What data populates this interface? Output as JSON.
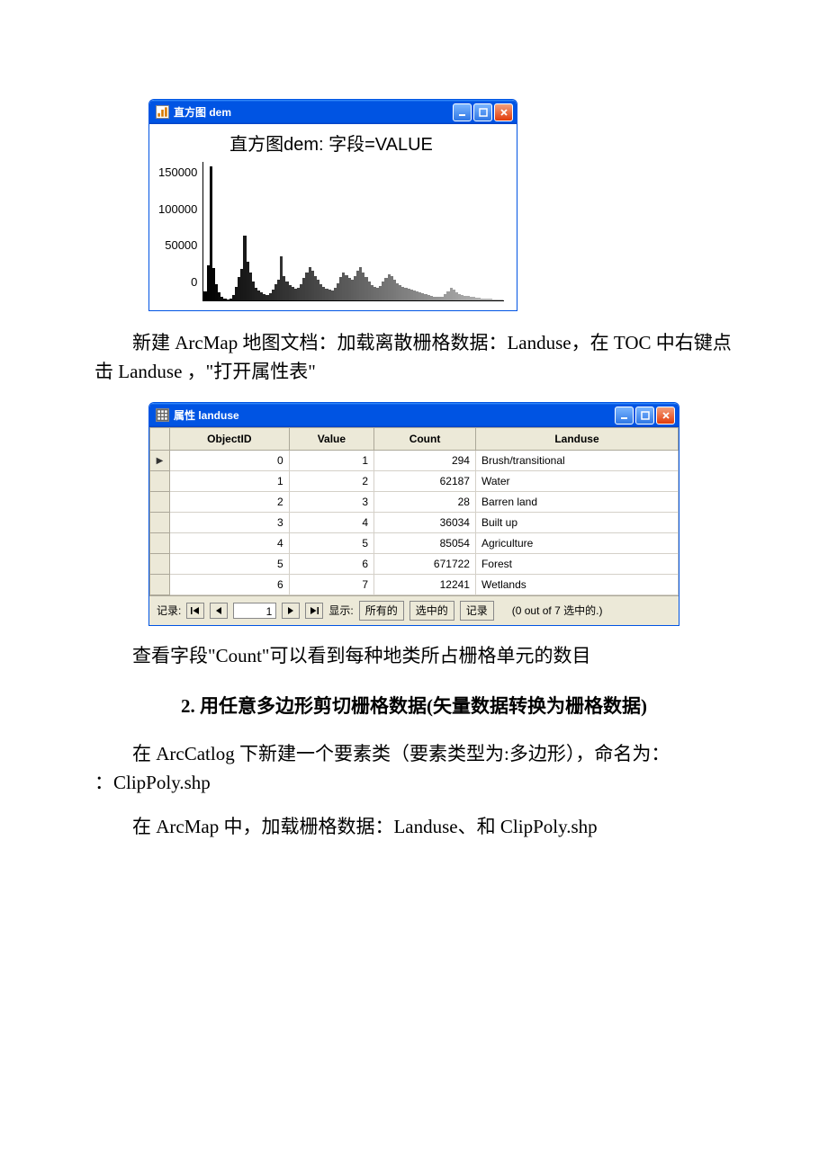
{
  "histogram": {
    "window_title": "直方图 dem",
    "chart_title": "直方图dem: 字段=VALUE",
    "y_ticks": [
      "150000",
      "100000",
      "50000",
      "0"
    ],
    "icons": {
      "minimize": "_",
      "maximize": "□",
      "close": "×"
    }
  },
  "chart_data": {
    "type": "bar",
    "title": "直方图dem: 字段=VALUE",
    "xlabel": "",
    "ylabel": "",
    "ylim": [
      0,
      150000
    ],
    "categories_note": "x represents VALUE bins (labels not shown in figure)",
    "values": [
      10000,
      38000,
      145000,
      35000,
      18000,
      9000,
      4000,
      2000,
      1000,
      2000,
      6000,
      15000,
      25000,
      34000,
      70000,
      42000,
      30000,
      20000,
      14000,
      11000,
      9000,
      7000,
      6000,
      8000,
      12000,
      18000,
      22000,
      48000,
      26000,
      20000,
      17000,
      15000,
      13000,
      14000,
      18000,
      24000,
      30000,
      36000,
      32000,
      26000,
      22000,
      18000,
      15000,
      13000,
      12000,
      11000,
      14000,
      19000,
      25000,
      30000,
      27000,
      24000,
      22000,
      26000,
      32000,
      36000,
      30000,
      25000,
      20000,
      17000,
      15000,
      14000,
      16000,
      20000,
      24000,
      28000,
      26000,
      22000,
      19000,
      17000,
      15000,
      14000,
      13000,
      12000,
      11000,
      10000,
      9000,
      8000,
      7000,
      6000,
      5000,
      4000,
      3500,
      3500,
      4000,
      7000,
      10000,
      14000,
      12000,
      9000,
      7000,
      5500,
      5000,
      4500,
      4000,
      3500,
      3000,
      2500,
      2200,
      2000,
      1800,
      1500,
      1200,
      1000,
      800,
      600
    ]
  },
  "para1_a": "新建 ",
  "para1_arcmap": "ArcMap ",
  "para1_b": "地图文档：加载离散栅格数据：",
  "para1_landuse": "Landuse",
  "para1_c": "，在 ",
  "para1_toc": "TOC ",
  "para1_d": "中右键点击 ",
  "para1_landuse2": "Landuse ",
  "para1_e": "，\"打开属性表\"",
  "attr": {
    "window_title": "属性 landuse",
    "columns": [
      "ObjectID",
      "Value",
      "Count",
      "Landuse"
    ],
    "rows": [
      {
        "ObjectID": "0",
        "Value": "1",
        "Count": "294",
        "Landuse": "Brush/transitional"
      },
      {
        "ObjectID": "1",
        "Value": "2",
        "Count": "62187",
        "Landuse": "Water"
      },
      {
        "ObjectID": "2",
        "Value": "3",
        "Count": "28",
        "Landuse": "Barren land"
      },
      {
        "ObjectID": "3",
        "Value": "4",
        "Count": "36034",
        "Landuse": "Built up"
      },
      {
        "ObjectID": "4",
        "Value": "5",
        "Count": "85054",
        "Landuse": "Agriculture"
      },
      {
        "ObjectID": "5",
        "Value": "6",
        "Count": "671722",
        "Landuse": "Forest"
      },
      {
        "ObjectID": "6",
        "Value": "7",
        "Count": "12241",
        "Landuse": "Wetlands"
      }
    ],
    "nav": {
      "label_record": "记录:",
      "current": "1",
      "label_show": "显示:",
      "btn_all": "所有的",
      "btn_selected": "选中的",
      "btn_record": "记录",
      "status": "(0 out of 7 选中的.)"
    }
  },
  "para2_a": "查看字段\"",
  "para2_count": "Count",
  "para2_b": "\"可以看到每种地类所占栅格单元的数目",
  "section2_title": "2. 用任意多边形剪切栅格数据(矢量数据转换为栅格数据)",
  "para3_a": "在 ",
  "para3_arccatlog": "ArcCatlog ",
  "para3_b": "下新建一个要素类（要素类型为:多边形），命名为：",
  "para3_clip": "ClipPoly.shp",
  "para4_a": "在 ",
  "para4_arcmap": "ArcMap ",
  "para4_b": "中，加载栅格数据：",
  "para4_landuse": "Landuse",
  "para4_c": "、和 ",
  "para4_clip": "ClipPoly.shp"
}
